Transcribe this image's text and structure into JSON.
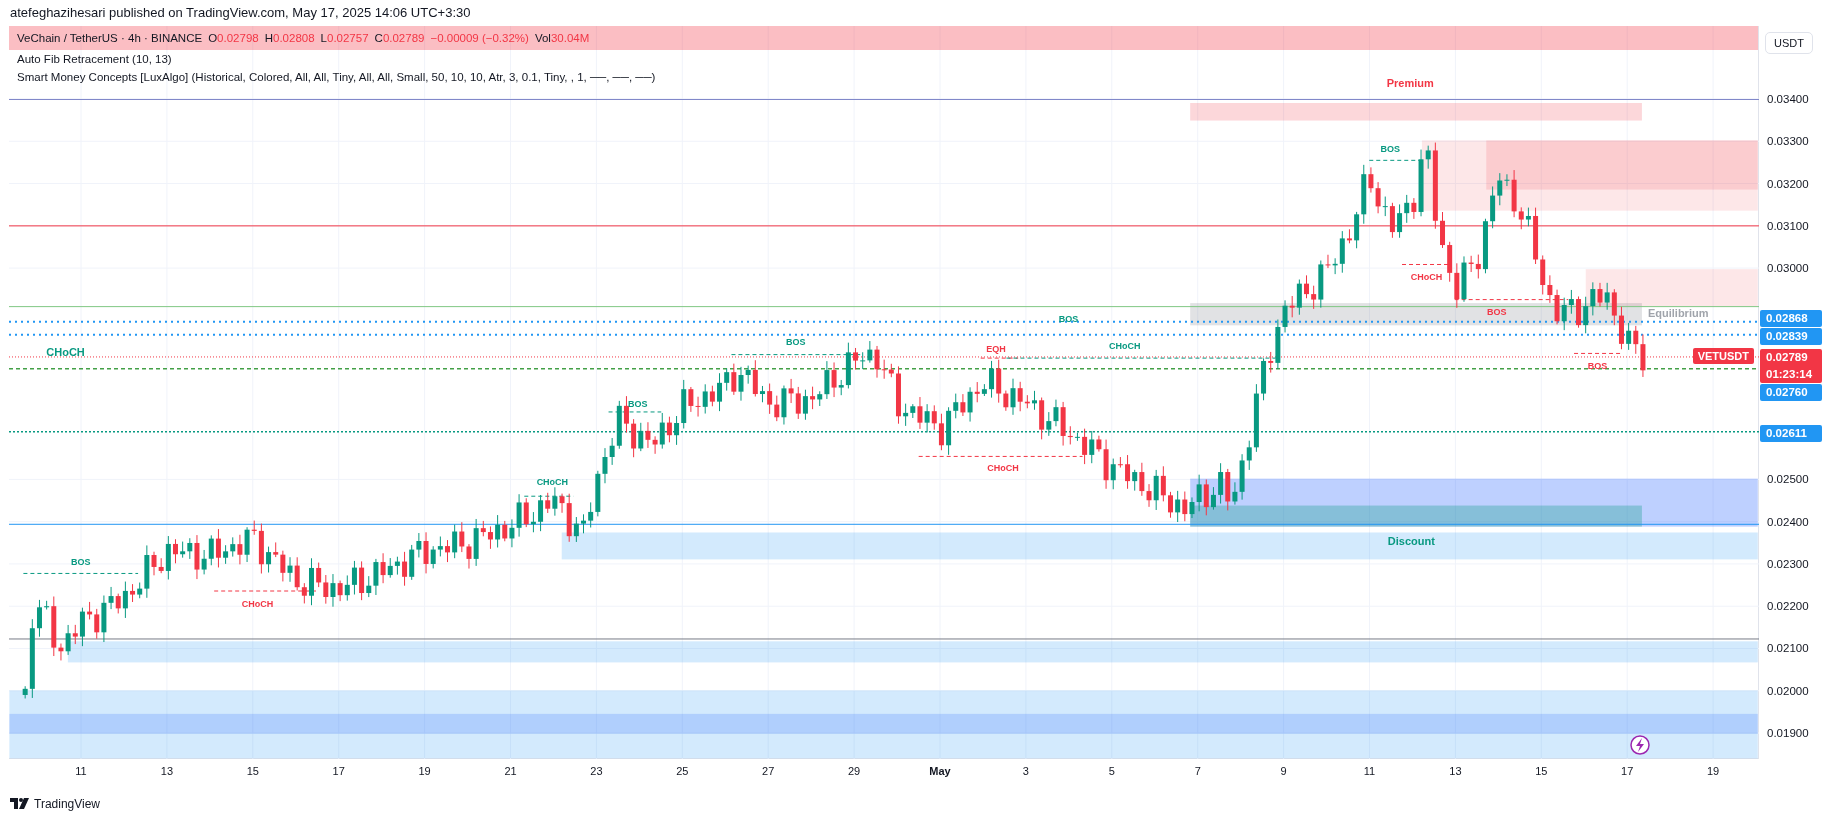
{
  "publisher": "atefeghazihesari published on TradingView.com, May 17, 2025 14:06 UTC+3:30",
  "legend": {
    "title": "VeChain / TetherUS · 4h · BINANCE",
    "ohlc": [
      {
        "letter": "O",
        "value": "0.02798"
      },
      {
        "letter": "H",
        "value": "0.02808"
      },
      {
        "letter": "L",
        "value": "0.02757"
      },
      {
        "letter": "C",
        "value": "0.02789"
      }
    ],
    "change": "−0.00009 (−0.32%)",
    "volume": {
      "label": "Vol",
      "value": "30.04M"
    },
    "indicators": [
      "Auto Fib Retracement (10, 13)",
      "Smart Money Concepts [LuxAlgo] (Historical, Colored, All, All, Tiny, All, All, Small, 50, 10, 10, Atr, 3, 0.1, Tiny, , 1, ──, ──, ──)"
    ]
  },
  "annotations": [
    {
      "text": "Premium",
      "kind": "zone",
      "color": "#f23645"
    },
    {
      "text": "BOS",
      "kind": "structure",
      "color": "#089981"
    },
    {
      "text": "CHoCH",
      "kind": "structure",
      "color": "#f23645"
    },
    {
      "text": "Equilibrium",
      "kind": "zone",
      "color": "#a0a4ab"
    },
    {
      "text": "BOS",
      "kind": "structure",
      "color": "#089981"
    },
    {
      "text": "BOS",
      "kind": "structure",
      "color": "#f23645"
    },
    {
      "text": "BOS",
      "kind": "structure",
      "color": "#089981"
    },
    {
      "text": "CHoCH",
      "kind": "swing",
      "color": "#089981"
    },
    {
      "text": "EQH",
      "kind": "structure",
      "color": "#f23645"
    },
    {
      "text": "CHoCH",
      "kind": "structure",
      "color": "#089981"
    },
    {
      "text": "BOS",
      "kind": "structure",
      "color": "#f23645"
    },
    {
      "text": "BOS",
      "kind": "structure",
      "color": "#089981"
    },
    {
      "text": "CHoCH",
      "kind": "structure",
      "color": "#f23645"
    },
    {
      "text": "CHoCH",
      "kind": "structure",
      "color": "#089981"
    },
    {
      "text": "Discount",
      "kind": "zone",
      "color": "#089981"
    },
    {
      "text": "BOS",
      "kind": "structure",
      "color": "#089981"
    },
    {
      "text": "CHoCH",
      "kind": "structure",
      "color": "#f23645"
    }
  ],
  "symbol_tag": "VETUSDT",
  "price_axis": {
    "currency": "USDT",
    "labels": [
      "0.03400",
      "0.03300",
      "0.03200",
      "0.03100",
      "0.03000",
      "0.02500",
      "0.02400",
      "0.02300",
      "0.02200",
      "0.02100",
      "0.02000",
      "0.01900"
    ],
    "tags": [
      {
        "value": "0.02868",
        "color": "#2196f3"
      },
      {
        "value": "0.02839",
        "color": "#2196f3"
      },
      {
        "value": "0.02789",
        "color": "#f23645",
        "countdown": "01:23:14"
      },
      {
        "value": "0.02760",
        "color": "#2196f3"
      },
      {
        "value": "0.02611",
        "color": "#2196f3"
      }
    ]
  },
  "time_axis": [
    {
      "label": "11",
      "month": false
    },
    {
      "label": "13",
      "month": false
    },
    {
      "label": "15",
      "month": false
    },
    {
      "label": "17",
      "month": false
    },
    {
      "label": "19",
      "month": false
    },
    {
      "label": "21",
      "month": false
    },
    {
      "label": "23",
      "month": false
    },
    {
      "label": "25",
      "month": false
    },
    {
      "label": "27",
      "month": false
    },
    {
      "label": "29",
      "month": false
    },
    {
      "label": "May",
      "month": true
    },
    {
      "label": "3",
      "month": false
    },
    {
      "label": "5",
      "month": false
    },
    {
      "label": "7",
      "month": false
    },
    {
      "label": "9",
      "month": false
    },
    {
      "label": "11",
      "month": false
    },
    {
      "label": "13",
      "month": false
    },
    {
      "label": "15",
      "month": false
    },
    {
      "label": "17",
      "month": false
    },
    {
      "label": "19",
      "month": false
    }
  ],
  "footer": {
    "brand": "TradingView"
  }
}
